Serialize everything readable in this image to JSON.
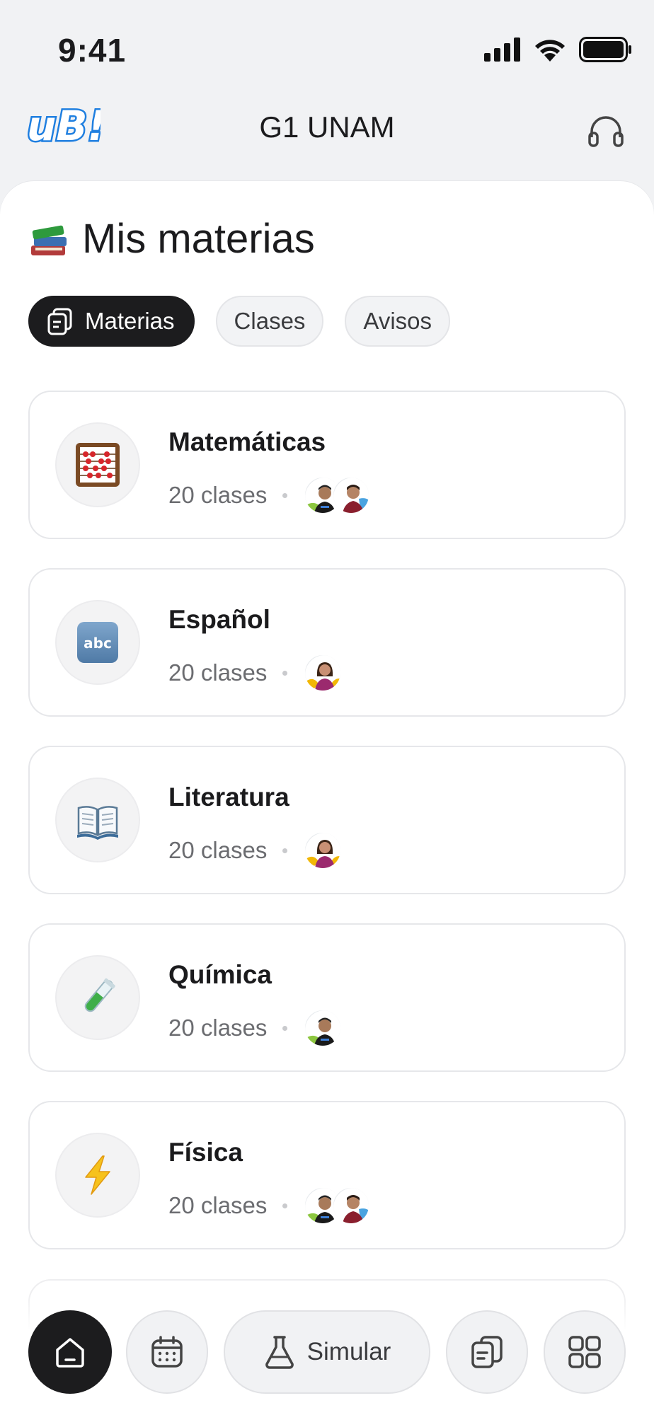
{
  "status_bar": {
    "time": "9:41"
  },
  "header": {
    "title": "G1 UNAM",
    "logo_text": "uB!"
  },
  "page": {
    "title": "Mis materias"
  },
  "tabs": [
    {
      "label": "Materias",
      "active": true,
      "icon": "cards-icon"
    },
    {
      "label": "Clases",
      "active": false
    },
    {
      "label": "Avisos",
      "active": false
    }
  ],
  "subjects": [
    {
      "name": "Matemáticas",
      "count": "20 clases",
      "icon": "abacus-icon",
      "avatars": 2
    },
    {
      "name": "Español",
      "count": "20 clases",
      "icon": "abc-icon",
      "avatars": 1
    },
    {
      "name": "Literatura",
      "count": "20 clases",
      "icon": "open-book-icon",
      "avatars": 1
    },
    {
      "name": "Química",
      "count": "20 clases",
      "icon": "test-tube-icon",
      "avatars": 1
    },
    {
      "name": "Física",
      "count": "20 clases",
      "icon": "lightning-icon",
      "avatars": 2
    }
  ],
  "bottom_nav": {
    "home": "home-icon",
    "calendar": "calendar-icon",
    "simulate_label": "Simular",
    "documents": "documents-icon",
    "menu": "grid-icon"
  },
  "colors": {
    "accent_dark": "#1c1c1e",
    "logo_blue": "#1f7fe0",
    "background": "#f1f2f4"
  }
}
